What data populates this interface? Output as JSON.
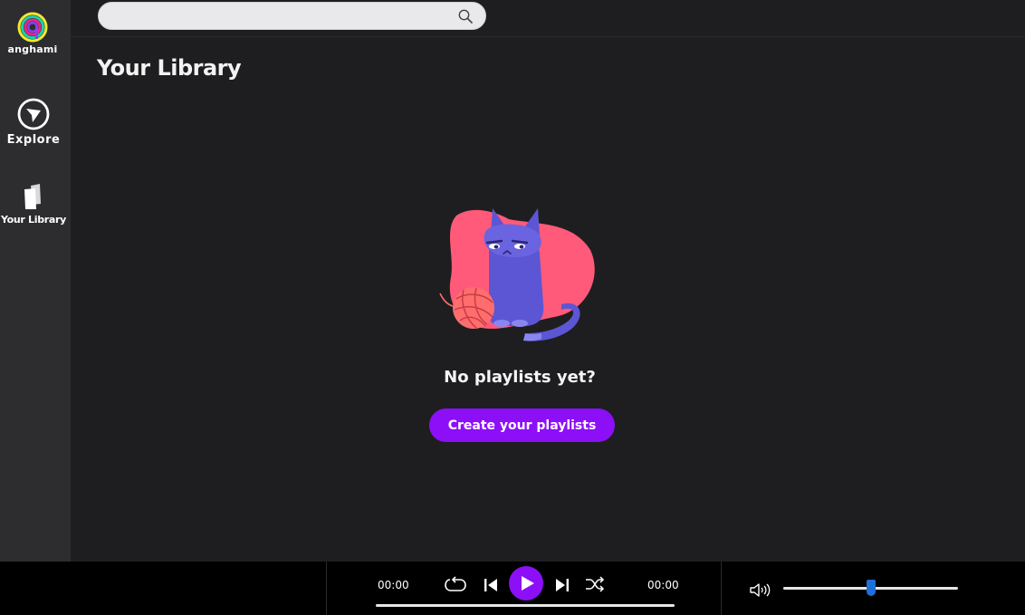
{
  "app": {
    "logo_text": "anghami"
  },
  "sidebar": {
    "items": [
      {
        "label": "Explore",
        "icon": "compass-icon"
      },
      {
        "label": "Your Library",
        "icon": "library-icon"
      }
    ]
  },
  "search": {
    "value": "",
    "placeholder": "",
    "icon": "search-icon"
  },
  "main": {
    "title": "Your Library",
    "empty_state": {
      "illustration": "grumpy-cat-with-yarn",
      "message": "No playlists yet?",
      "cta_label": "Create your playlists"
    }
  },
  "player": {
    "current_time": "00:00",
    "total_time": "00:00",
    "progress": 0,
    "volume": 0.5,
    "controls": [
      "repeat-icon",
      "previous-icon",
      "play-icon",
      "next-icon",
      "shuffle-icon",
      "volume-icon"
    ]
  },
  "colors": {
    "accent": "#8c0ff7",
    "background": "#1e1e20",
    "sidebar": "#2d2d30",
    "player": "#000000",
    "volume_thumb": "#1f6fd6"
  }
}
